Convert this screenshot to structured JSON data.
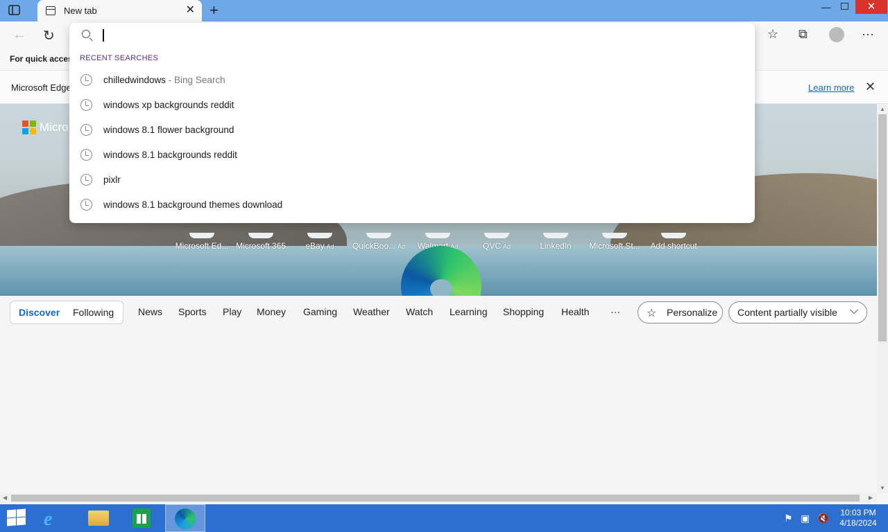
{
  "tabs": [
    {
      "title": "New tab"
    }
  ],
  "window": {
    "min": "—",
    "close": "✕",
    "newtab": "+",
    "tab_close": "✕"
  },
  "toolbar": {
    "back": "←",
    "refresh": "↻",
    "favorites": "☆",
    "collections": "⧉",
    "more": "···"
  },
  "favbar": {
    "text": "For quick access"
  },
  "infobar": {
    "text": "Microsoft Edge",
    "link": "Learn more",
    "close": "✕"
  },
  "hero": {
    "brand": "Micro"
  },
  "shortcuts": [
    {
      "label": "Microsoft Ed...",
      "ad": ""
    },
    {
      "label": "Microsoft 365",
      "ad": ""
    },
    {
      "label": "eBay",
      "ad": "Ad"
    },
    {
      "label": "QuickBoo...",
      "ad": "Ad"
    },
    {
      "label": "Walmart",
      "ad": "Ad"
    },
    {
      "label": "QVC",
      "ad": "Ad"
    },
    {
      "label": "LinkedIn",
      "ad": ""
    },
    {
      "label": "Microsoft St...",
      "ad": ""
    },
    {
      "label": "Add shortcut",
      "ad": ""
    }
  ],
  "feed": {
    "segments": [
      "Discover",
      "Following"
    ],
    "items": [
      "News",
      "Sports",
      "Play",
      "Money",
      "Gaming",
      "Weather",
      "Watch",
      "Learning",
      "Shopping",
      "Health",
      "···"
    ],
    "personalize": "Personalize",
    "visibility": "Content partially visible",
    "star": "☆",
    "chevron": "⌵"
  },
  "dropdown": {
    "header": "RECENT SEARCHES",
    "suggestions": [
      {
        "query": "chilledwindows",
        "source": " - Bing Search"
      },
      {
        "query": "windows xp backgrounds reddit",
        "source": ""
      },
      {
        "query": "windows 8.1 flower background",
        "source": ""
      },
      {
        "query": "windows 8.1 backgrounds reddit",
        "source": ""
      },
      {
        "query": "pixlr",
        "source": ""
      },
      {
        "query": "windows 8.1 background themes download",
        "source": ""
      }
    ]
  },
  "scroll": {
    "up": "▲",
    "down": "▼",
    "left": "◀",
    "right": "▶"
  },
  "taskbar": {
    "time": "10:03 PM",
    "date": "4/18/2024",
    "ie": "e",
    "tray": {
      "flag": "⚑",
      "network": "▣",
      "volume": "🔇"
    }
  },
  "colors": {
    "accent": "#0f6cbd",
    "titlebar": "#6fa8e8",
    "taskbar": "#2c6fd0",
    "close": "#d9342b"
  }
}
